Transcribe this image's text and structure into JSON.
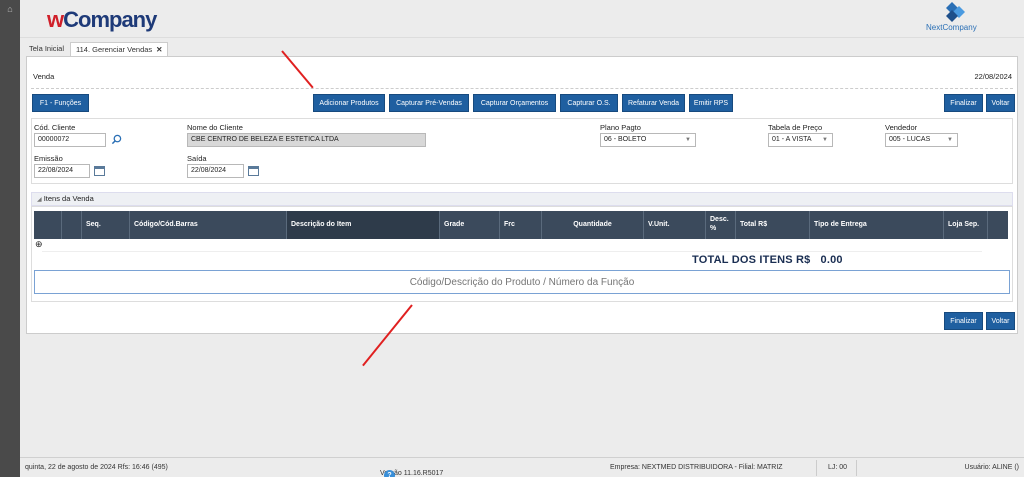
{
  "header": {
    "logo_w": "w",
    "logo_rest": "Company",
    "brand_right": "NextCompany"
  },
  "tabs": [
    {
      "label": "Tela Inicial"
    },
    {
      "label": "114. Gerenciar Vendas",
      "close": "✕"
    }
  ],
  "page": {
    "title": "Venda",
    "date": "22/08/2024"
  },
  "toolbar": {
    "functions": "F1 - Funções",
    "add_products": "Adicionar Produtos",
    "capture_presales": "Capturar Pré-Vendas",
    "capture_quotes": "Capturar Orçamentos",
    "capture_os": "Capturar O.S.",
    "reinvoice": "Refaturar Venda",
    "issue_rps": "Emitir RPS",
    "finish": "Finalizar",
    "back": "Voltar"
  },
  "form": {
    "client_code_label": "Cód. Cliente",
    "client_code": "00000072",
    "client_name_label": "Nome do Cliente",
    "client_name": "CBE CENTRO DE BELEZA E ESTETICA LTDA",
    "payment_plan_label": "Plano Pagto",
    "payment_plan": "06 - BOLETO",
    "price_table_label": "Tabela de Preço",
    "price_table": "01 - A VISTA",
    "seller_label": "Vendedor",
    "seller": "005 - LUCAS",
    "issue_label": "Emissão",
    "issue_date": "22/08/2024",
    "exit_label": "Saída",
    "exit_date": "22/08/2024"
  },
  "items": {
    "section_title": "Itens da Venda",
    "columns": [
      "Seq.",
      "Código/Cód.Barras",
      "Descrição do Item",
      "Grade",
      "Frc",
      "Quantidade",
      "V.Unit.",
      "Desc. %",
      "Total R$",
      "Tipo de Entrega",
      "Loja Sep."
    ],
    "total_label": "TOTAL DOS ITENS R$",
    "total_value": "0.00",
    "search_placeholder": "Código/Descrição do Produto / Número da Função"
  },
  "footer": {
    "datetime": "quinta, 22 de agosto de 2024  Rfs: 16:46 (495)",
    "version": "Versão 11.16.R5017",
    "company": "Empresa: NEXTMED DISTRIBUIDORA - Filial: MATRIZ",
    "store": "LJ: 00",
    "user": "Usuário: ALINE ()"
  },
  "colors": {
    "button": "#1f5fa0",
    "table_header": "#3b4a5c",
    "arrow": "#e02020"
  }
}
